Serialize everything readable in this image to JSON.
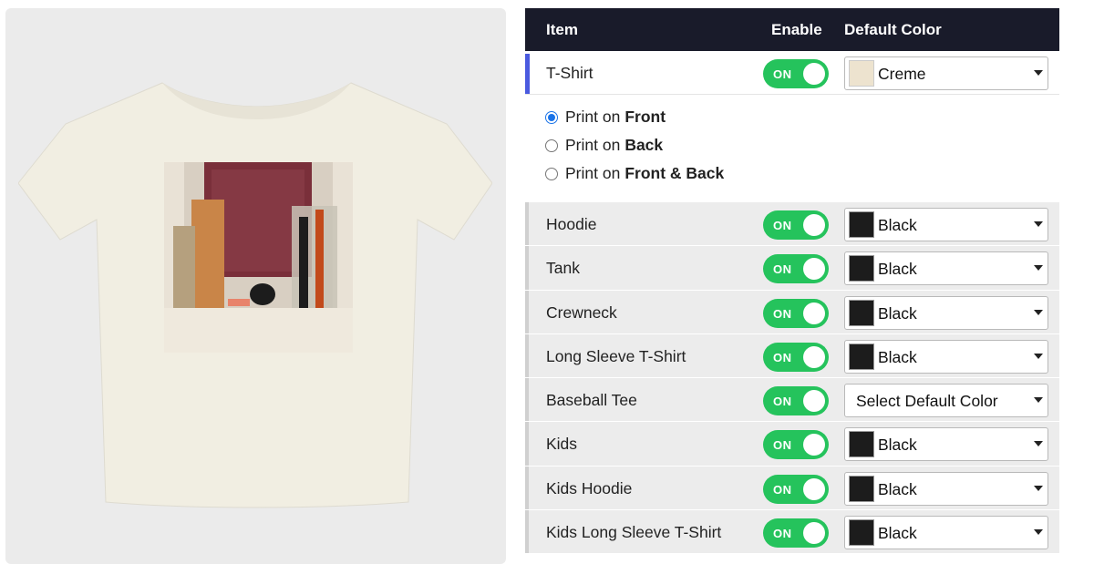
{
  "header": {
    "item": "Item",
    "enable": "Enable",
    "default_color": "Default Color"
  },
  "products": [
    {
      "name": "T-Shirt",
      "toggle": "ON",
      "color": "Creme",
      "swatch": "#ede3cf"
    },
    {
      "name": "Hoodie",
      "toggle": "ON",
      "color": "Black",
      "swatch": "#1c1c1c"
    },
    {
      "name": "Tank",
      "toggle": "ON",
      "color": "Black",
      "swatch": "#1c1c1c"
    },
    {
      "name": "Crewneck",
      "toggle": "ON",
      "color": "Black",
      "swatch": "#1c1c1c"
    },
    {
      "name": "Long Sleeve T-Shirt",
      "toggle": "ON",
      "color": "Black",
      "swatch": "#1c1c1c"
    },
    {
      "name": "Baseball Tee",
      "toggle": "ON",
      "color": "Select Default Color",
      "swatch": ""
    },
    {
      "name": "Kids",
      "toggle": "ON",
      "color": "Black",
      "swatch": "#1c1c1c"
    },
    {
      "name": "Kids Hoodie",
      "toggle": "ON",
      "color": "Black",
      "swatch": "#1c1c1c"
    },
    {
      "name": "Kids Long Sleeve T-Shirt",
      "toggle": "ON",
      "color": "Black",
      "swatch": "#1c1c1c"
    }
  ],
  "print_options": [
    {
      "prefix": "Print on",
      "side": "Front",
      "checked": true
    },
    {
      "prefix": "Print on",
      "side": "Back",
      "checked": false
    },
    {
      "prefix": "Print on",
      "side": "Front & Back",
      "checked": false
    }
  ],
  "colors": {
    "header_bg": "#191b2a",
    "toggle_on": "#25c35c",
    "accent": "#4a5adf",
    "shirt": "#f3f0e4"
  }
}
